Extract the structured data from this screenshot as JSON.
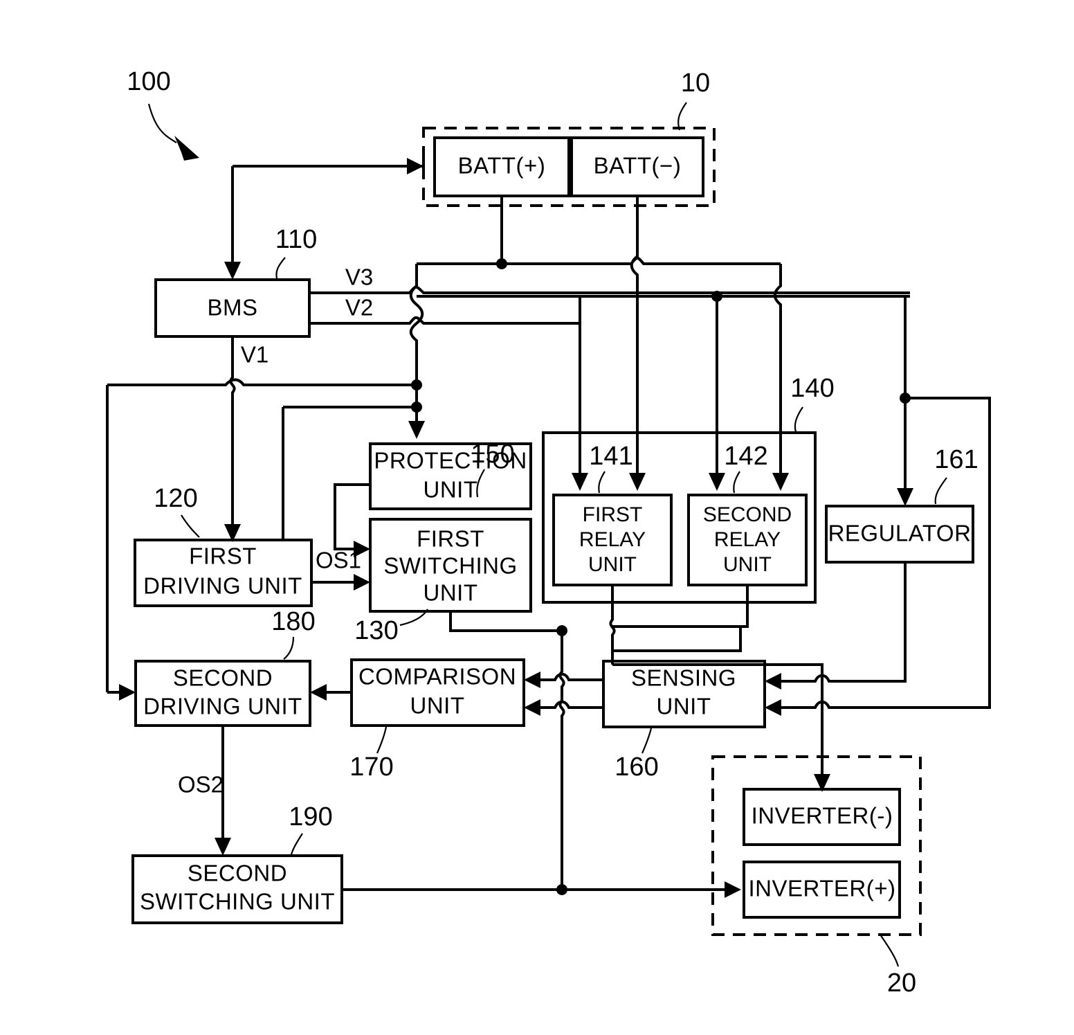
{
  "figure": {
    "type": "patent-block-diagram",
    "title": "",
    "background": "#ffffff",
    "line_color": "#000000"
  },
  "reference_numerals": {
    "system": "100",
    "battery_pack": "10",
    "bms": "110",
    "first_driving_unit": "120",
    "first_switching_unit": "130",
    "relay_group": "140",
    "first_relay_unit": "141",
    "second_relay_unit": "142",
    "protection_unit": "150",
    "sensing_unit": "160",
    "regulator": "161",
    "comparison_unit": "170",
    "second_driving_unit": "180",
    "second_switching_unit": "190",
    "inverter_group": "20"
  },
  "blocks": {
    "batt_pos": {
      "label": "BATT(+)",
      "ref": ""
    },
    "batt_neg": {
      "label": "BATT(−)",
      "ref": ""
    },
    "bms": {
      "label": "BMS",
      "ref": "110"
    },
    "first_driving_unit": {
      "label_line1": "FIRST",
      "label_line2": "DRIVING UNIT",
      "ref": "120"
    },
    "protection_unit": {
      "label_line1": "PROTECTION",
      "label_line2": "UNIT",
      "ref": "150"
    },
    "first_switching_unit": {
      "label_line1": "FIRST",
      "label_line2": "SWITCHING",
      "label_line3": "UNIT",
      "ref": "130"
    },
    "first_relay_unit": {
      "label_line1": "FIRST",
      "label_line2": "RELAY",
      "label_line3": "UNIT",
      "ref": "141"
    },
    "second_relay_unit": {
      "label_line1": "SECOND",
      "label_line2": "RELAY",
      "label_line3": "UNIT",
      "ref": "142"
    },
    "relay_group": {
      "ref": "140"
    },
    "regulator": {
      "label": "REGULATOR",
      "ref": "161"
    },
    "second_driving_unit": {
      "label_line1": "SECOND",
      "label_line2": "DRIVING UNIT",
      "ref": "180"
    },
    "comparison_unit": {
      "label_line1": "COMPARISON",
      "label_line2": "UNIT",
      "ref": "170"
    },
    "sensing_unit": {
      "label_line1": "SENSING",
      "label_line2": "UNIT",
      "ref": "160"
    },
    "second_switching_unit": {
      "label_line1": "SECOND",
      "label_line2": "SWITCHING UNIT",
      "ref": "190"
    },
    "inverter_neg": {
      "label": "INVERTER(-)",
      "ref": ""
    },
    "inverter_pos": {
      "label": "INVERTER(+)",
      "ref": ""
    },
    "battery_group": {
      "ref": "10"
    },
    "inverter_group": {
      "ref": "20"
    }
  },
  "signals": {
    "v1": "V1",
    "v2": "V2",
    "v3": "V3",
    "os1": "OS1",
    "os2": "OS2"
  }
}
